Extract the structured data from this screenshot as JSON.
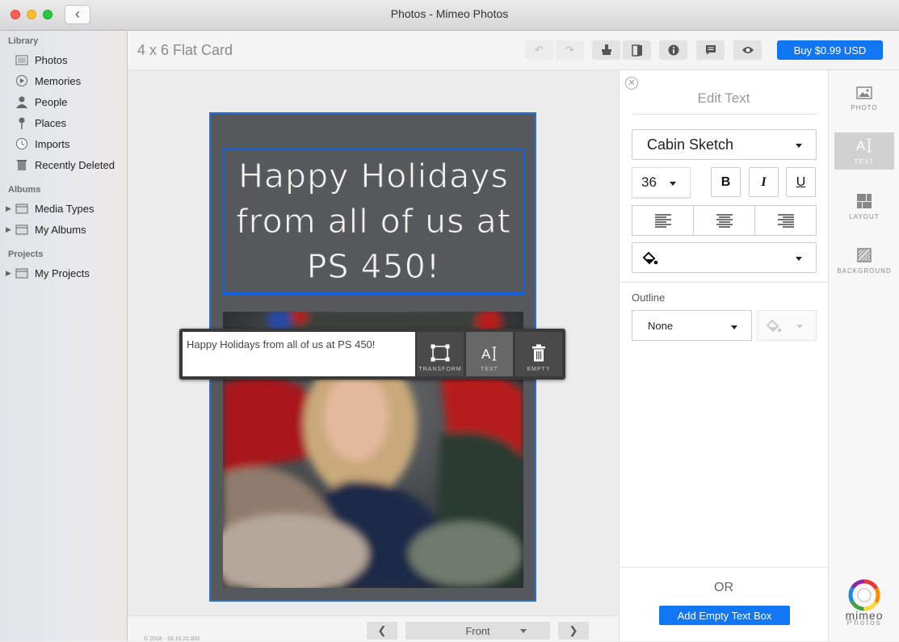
{
  "window": {
    "title": "Photos - Mimeo Photos"
  },
  "sidebar": {
    "sections": [
      {
        "label": "Library"
      },
      {
        "label": "Albums"
      },
      {
        "label": "Projects"
      }
    ],
    "library_items": [
      {
        "label": "Photos",
        "icon": "photos-icon"
      },
      {
        "label": "Memories",
        "icon": "memories-icon"
      },
      {
        "label": "People",
        "icon": "people-icon"
      },
      {
        "label": "Places",
        "icon": "places-icon"
      },
      {
        "label": "Imports",
        "icon": "imports-icon"
      },
      {
        "label": "Recently Deleted",
        "icon": "trash-icon"
      }
    ],
    "album_items": [
      {
        "label": "Media Types",
        "icon": "folder-icon"
      },
      {
        "label": "My Albums",
        "icon": "folder-icon"
      }
    ],
    "project_items": [
      {
        "label": "My Projects",
        "icon": "folder-icon"
      }
    ]
  },
  "toolbar": {
    "card_title": "4 x 6 Flat Card",
    "buy_label": "Buy $0.99 USD",
    "accent": "#1176f3"
  },
  "card": {
    "headline_lines": [
      "Happy Holidays",
      "from all of us at",
      "PS 450!"
    ],
    "background": "#55595c"
  },
  "floating_toolbar": {
    "text_value": "Happy Holidays from all of us at PS 450!",
    "transform_label": "TRANSFORM",
    "text_label": "TEXT",
    "empty_label": "EMPTY"
  },
  "bottom": {
    "copyright": "© 2018 - 18.10.22.831",
    "page_select": "Front"
  },
  "edit_panel": {
    "title": "Edit Text",
    "font": "Cabin Sketch",
    "size": "36",
    "bold_label": "B",
    "italic_label": "I",
    "underline_label": "U",
    "outline_label": "Outline",
    "outline_value": "None",
    "or_label": "OR",
    "add_label": "Add Empty Text Box"
  },
  "rail": {
    "items": [
      {
        "label": "PHOTO",
        "icon": "photo-icon"
      },
      {
        "label": "TEXT",
        "icon": "text-icon"
      },
      {
        "label": "LAYOUT",
        "icon": "layout-icon"
      },
      {
        "label": "BACKGROUND",
        "icon": "background-icon"
      }
    ],
    "logo_word": "mimeo",
    "logo_sub": "Photos"
  }
}
